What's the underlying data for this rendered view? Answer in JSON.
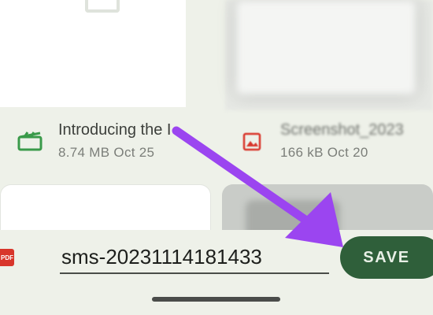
{
  "files": [
    {
      "name": "Introducing the I",
      "meta": "8.74 MB Oct 25",
      "icon": "video-clapper-icon",
      "icon_color": "#3a9a4a"
    },
    {
      "name": "Screenshot_2023",
      "meta": "166 kB Oct 20",
      "icon": "image-icon",
      "icon_color": "#d8362b"
    }
  ],
  "save_bar": {
    "filename_value": "sms-20231114181433",
    "save_label": "SAVE",
    "file_type_icon_label": "PDF"
  },
  "colors": {
    "background": "#eef1e9",
    "accent": "#2f5f3a",
    "arrow": "#9b45f0"
  }
}
